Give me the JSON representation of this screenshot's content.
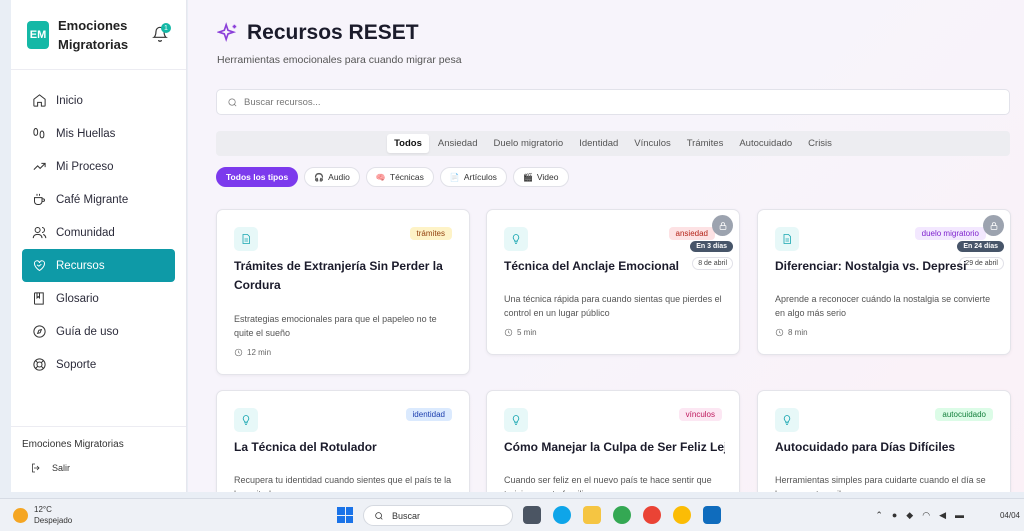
{
  "brand": {
    "logo": "EM",
    "name": "Emociones Migratorias",
    "notifications": "1"
  },
  "nav": [
    {
      "label": "Inicio",
      "icon": "home-icon"
    },
    {
      "label": "Mis Huellas",
      "icon": "footprints-icon"
    },
    {
      "label": "Mi Proceso",
      "icon": "trending-icon"
    },
    {
      "label": "Café Migrante",
      "icon": "coffee-icon"
    },
    {
      "label": "Comunidad",
      "icon": "users-icon"
    },
    {
      "label": "Recursos",
      "icon": "heart-handshake-icon",
      "active": true
    },
    {
      "label": "Glosario",
      "icon": "book-icon"
    },
    {
      "label": "Guía de uso",
      "icon": "compass-icon"
    },
    {
      "label": "Soporte",
      "icon": "lifebuoy-icon"
    }
  ],
  "sidebar_footer": {
    "app_name": "Emociones Migratorias",
    "logout": "Salir"
  },
  "header": {
    "title": "Recursos RESET",
    "subtitle": "Herramientas emocionales para cuando migrar pesa"
  },
  "search": {
    "placeholder": "Buscar recursos..."
  },
  "tabs": [
    "Todos",
    "Ansiedad",
    "Duelo migratorio",
    "Identidad",
    "Vínculos",
    "Trámites",
    "Autocuidado",
    "Crisis"
  ],
  "type_filters": [
    {
      "label": "Todos los tipos",
      "active": true
    },
    {
      "label": "Audio",
      "icon": "headphones-icon"
    },
    {
      "label": "Técnicas",
      "icon": "brain-icon"
    },
    {
      "label": "Artículos",
      "icon": "document-icon"
    },
    {
      "label": "Video",
      "icon": "video-icon"
    }
  ],
  "cards": [
    {
      "title": "Trámites de Extranjería Sin Perder la Cordura",
      "tag": "trámites",
      "desc": "Estrategias emocionales para que el papeleo no te quite el sueño",
      "duration": "12 min",
      "type_icon": "document-icon"
    },
    {
      "title": "Técnica del Anclaje Emocional",
      "tag": "ansiedad",
      "desc": "Una técnica rápida para cuando sientas que pierdes el control en un lugar público",
      "duration": "5 min",
      "locked": true,
      "when": "En 3 días",
      "date": "8 de abril",
      "type_icon": "lightbulb-icon"
    },
    {
      "title": "Diferenciar: Nostalgia vs. Depresión",
      "tag": "duelo migratorio",
      "desc": "Aprende a reconocer cuándo la nostalgia se convierte en algo más serio",
      "duration": "8 min",
      "locked": true,
      "when": "En 24 días",
      "date": "29 de abril",
      "type_icon": "document-icon"
    },
    {
      "title": "La Técnica del Rotulador",
      "tag": "identidad",
      "desc": "Recupera tu identidad cuando sientes que el país te la ha quitado",
      "type_icon": "lightbulb-icon"
    },
    {
      "title": "Cómo Manejar la Culpa de Ser Feliz Lejos",
      "tag": "vínculos",
      "desc": "Cuando ser feliz en el nuevo país te hace sentir que traicionas a tu familia",
      "type_icon": "lightbulb-icon"
    },
    {
      "title": "Autocuidado para Días Difíciles",
      "tag": "autocuidado",
      "desc": "Herramientas simples para cuidarte cuando el día se hace cuesta arriba",
      "type_icon": "lightbulb-icon"
    }
  ],
  "taskbar": {
    "temp": "12°C",
    "weather": "Despejado",
    "search": "Buscar",
    "date": "04/04"
  },
  "colors": {
    "accent": "#7c3aed",
    "nav_active": "#0e9aa7",
    "teal": "#17a5b0"
  }
}
